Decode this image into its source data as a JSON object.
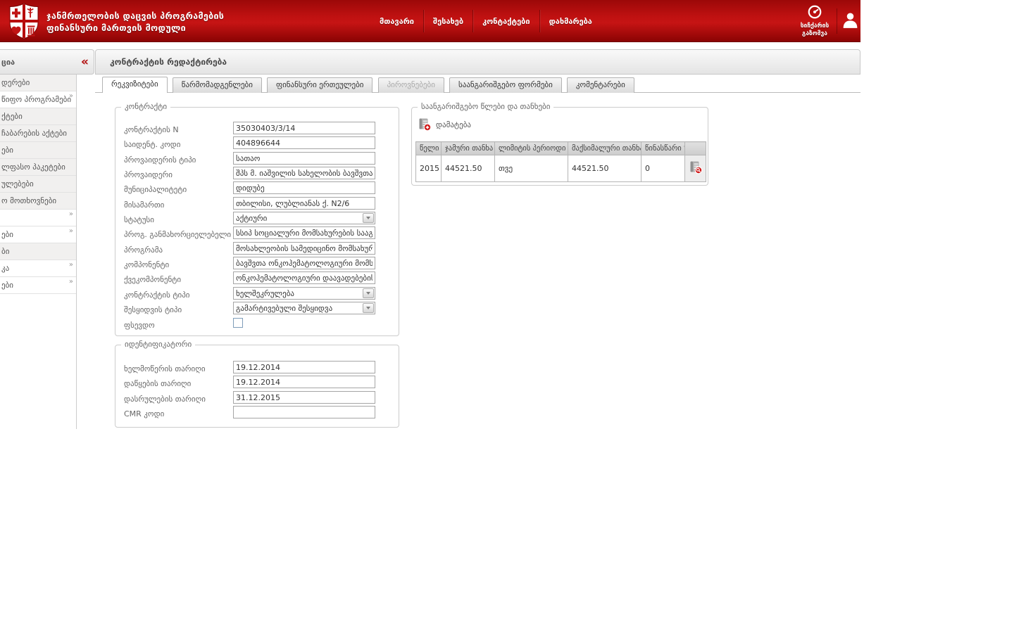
{
  "header": {
    "title_line1": "ჯანმრთელობის დაცვის პროგრამების",
    "title_line2": "ფინანსური მართვის მოდული",
    "nav": [
      {
        "label": "მთავარი"
      },
      {
        "label": "შესახებ"
      },
      {
        "label": "კონტაქტები"
      },
      {
        "label": "დახმარება"
      }
    ],
    "speed_line1": "სიჩქარის",
    "speed_line2": "გაზომვა"
  },
  "sidebar": {
    "header_fragment": "ცია",
    "collapse_glyph": "«",
    "submenu_glyph": "»",
    "items": [
      {
        "label": "დერები"
      },
      {
        "label": "წიფო პროგრამები"
      },
      {
        "label": "ქტები"
      },
      {
        "label": "ჩაბარების აქტები"
      },
      {
        "label": "ები"
      },
      {
        "label": "ლფასო პაკეტები"
      },
      {
        "label": "ულებები"
      },
      {
        "label": "ო მოთხოვნები"
      },
      {
        "label": ""
      },
      {
        "label": "ები"
      },
      {
        "label": "ბი"
      },
      {
        "label": "კა"
      },
      {
        "label": "ები"
      }
    ]
  },
  "main": {
    "page_title": "კონტრაქტის რედაქტირება",
    "tabs": [
      {
        "label": "რეკვიზიტები"
      },
      {
        "label": "წარმომადგენლები"
      },
      {
        "label": "ფინანსური ერთეულები"
      },
      {
        "label": "პიროვნებები"
      },
      {
        "label": "საანგარიშგებო ფორმები"
      },
      {
        "label": "კომენტარები"
      }
    ],
    "contract": {
      "legend": "კონტრაქტი",
      "fields": [
        {
          "label": "კონტრაქტის N",
          "value": "35030403/3/14"
        },
        {
          "label": "საიდენტ. კოდი",
          "value": "404896644"
        },
        {
          "label": "პროვაიდერის ტიპი",
          "value": "სათაო"
        },
        {
          "label": "პროვაიდერი",
          "value": "შპს მ. იაშვილის სახელობის ბავშვთა ცენტრალ"
        },
        {
          "label": "მუნიციპალიტეტი",
          "value": "დიდუბე"
        },
        {
          "label": "მისამართი",
          "value": "თბილისი, ლუბლიანას ქ. N2/6"
        },
        {
          "label": "სტატუსი",
          "value": "აქტიური"
        },
        {
          "label": "პროგ. განმახორციელებელი",
          "value": "სსიპ სოციალური მომსახურების სააგენტო"
        },
        {
          "label": "პროგრამა",
          "value": "მოსახლეობის სამედიცინო მომსახურების"
        },
        {
          "label": "კომპონენტი",
          "value": "ბავშვთა ონკოჰემატოლოგიური მომსახურე"
        },
        {
          "label": "ქვეკომპონენტი",
          "value": "ონკოჰემატოლოგიური დაავადებების მქონ"
        },
        {
          "label": "კონტრაქტის ტიპი",
          "value": "ხელშეკრულება"
        },
        {
          "label": "შესყიდვის ტიპი",
          "value": "გამარტივებული შესყიდვა"
        },
        {
          "label": "ფსევდო",
          "value": ""
        }
      ]
    },
    "identifier": {
      "legend": "იდენტიფიკატორი",
      "fields": [
        {
          "label": "ხელმოწერის თარიღი",
          "value": "19.12.2014"
        },
        {
          "label": "დაწყების თარიღი",
          "value": "19.12.2014"
        },
        {
          "label": "დასრულების თარიღი",
          "value": "31.12.2015"
        },
        {
          "label": "CMR კოდი",
          "value": ""
        }
      ]
    },
    "years": {
      "legend": "საანგარიშგებო წლები და თანხები",
      "add_label": "დამატება",
      "table": {
        "headers": [
          "წელი",
          "ჯამური თანხა",
          "ლიმიტის პერიოდი",
          "მაქსიმალური თანხა",
          "წინასწარი %"
        ],
        "row": {
          "year": "2015",
          "total": "44521.50",
          "limit_period": "თვე",
          "max_amount": "44521.50",
          "advance_pct": "0"
        }
      }
    }
  },
  "colors": {
    "header_red_top": "#9c0808",
    "header_red_mid": "#c61414",
    "accent_red": "#c01414",
    "panel_gray": "#e4e4e4"
  }
}
